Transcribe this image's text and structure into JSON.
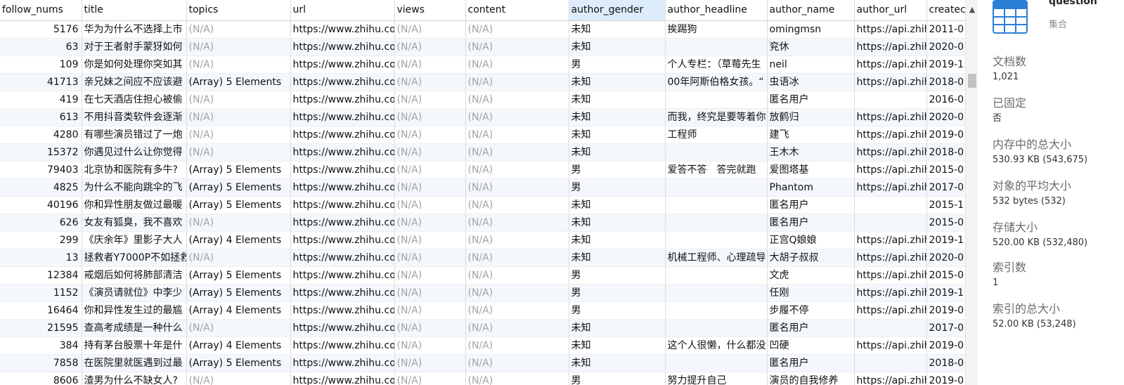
{
  "grid": {
    "columns": [
      {
        "key": "follow_nums",
        "label": "follow_nums",
        "width": 116
      },
      {
        "key": "title",
        "label": "title",
        "width": 149
      },
      {
        "key": "topics",
        "label": "topics",
        "width": 148
      },
      {
        "key": "url",
        "label": "url",
        "width": 148
      },
      {
        "key": "views",
        "label": "views",
        "width": 101
      },
      {
        "key": "content",
        "label": "content",
        "width": 147
      },
      {
        "key": "author_gender",
        "label": "author_gender",
        "width": 137,
        "selected": true
      },
      {
        "key": "author_headline",
        "label": "author_headline",
        "width": 145
      },
      {
        "key": "author_name",
        "label": "author_name",
        "width": 124
      },
      {
        "key": "author_url",
        "label": "author_url",
        "width": 103
      },
      {
        "key": "created",
        "label": "createc",
        "width": 55
      }
    ],
    "rows": [
      [
        "5176",
        "华为为什么不选择上市",
        "(N/A)",
        "https://www.zhihu.com",
        "(N/A)",
        "(N/A)",
        "未知",
        "挨踢狗",
        "omingmsn",
        "https://api.zhihu",
        "2011-0"
      ],
      [
        "63",
        "对于王者射手蒙犽如何",
        "(N/A)",
        "https://www.zhihu.com",
        "(N/A)",
        "(N/A)",
        "未知",
        "",
        "兖休",
        "https://api.zhihu",
        "2020-0"
      ],
      [
        "109",
        "你是如何处理你突如其",
        "(N/A)",
        "https://www.zhihu.com",
        "(N/A)",
        "(N/A)",
        "男",
        "个人专栏：（草莓先生",
        "neil",
        "https://api.zhihu",
        "2019-1"
      ],
      [
        "41713",
        "亲兄妹之间应不应该避",
        "(Array) 5 Elements",
        "https://www.zhihu.com",
        "(N/A)",
        "(N/A)",
        "未知",
        "00年阿斯伯格女孩。“",
        "虫语冰",
        "https://api.zhihu",
        "2018-0"
      ],
      [
        "419",
        "在七天酒店住担心被偷",
        "(N/A)",
        "https://www.zhihu.com",
        "(N/A)",
        "(N/A)",
        "未知",
        "",
        "匿名用户",
        "",
        "2016-0"
      ],
      [
        "613",
        "不用抖音类软件会逐渐",
        "(N/A)",
        "https://www.zhihu.com",
        "(N/A)",
        "(N/A)",
        "未知",
        "而我，终究是要等着你",
        "放鹤归",
        "https://api.zhihu",
        "2020-0"
      ],
      [
        "4280",
        "有哪些演员错过了一炮",
        "(N/A)",
        "https://www.zhihu.com",
        "(N/A)",
        "(N/A)",
        "未知",
        "工程师",
        "建飞",
        "https://api.zhihu",
        "2019-0"
      ],
      [
        "15372",
        "你遇见过什么让你觉得",
        "(N/A)",
        "https://www.zhihu.com",
        "(N/A)",
        "(N/A)",
        "未知",
        "",
        "王木木",
        "https://api.zhihu",
        "2018-0"
      ],
      [
        "79403",
        "北京协和医院有多牛?",
        "(Array) 5 Elements",
        "https://www.zhihu.com",
        "(N/A)",
        "(N/A)",
        "男",
        "爱答不答　答完就跑",
        "爱图塔基",
        "https://api.zhihu",
        "2015-0"
      ],
      [
        "4825",
        "为什么不能向跳伞的飞",
        "(Array) 5 Elements",
        "https://www.zhihu.com",
        "(N/A)",
        "(N/A)",
        "男",
        "",
        "Phantom",
        "https://api.zhihu",
        "2017-0"
      ],
      [
        "40196",
        "你和异性朋友做过最暖",
        "(Array) 5 Elements",
        "https://www.zhihu.com",
        "(N/A)",
        "(N/A)",
        "未知",
        "",
        "匿名用户",
        "",
        "2015-1"
      ],
      [
        "626",
        "女友有狐臭，我不喜欢",
        "(N/A)",
        "https://www.zhihu.com",
        "(N/A)",
        "(N/A)",
        "未知",
        "",
        "匿名用户",
        "",
        "2015-0"
      ],
      [
        "299",
        "《庆余年》里影子大人",
        "(Array) 4 Elements",
        "https://www.zhihu.com",
        "(N/A)",
        "(N/A)",
        "未知",
        "",
        "正宫Q娘娘",
        "https://api.zhihu",
        "2019-1"
      ],
      [
        "13",
        "拯救者Y7000P不如拯救",
        "(N/A)",
        "https://www.zhihu.com",
        "(N/A)",
        "(N/A)",
        "未知",
        "机械工程师、心理疏导",
        "大胡子叔叔",
        "https://api.zhihu",
        "2020-0"
      ],
      [
        "12384",
        "戒烟后如何将肺部清洁",
        "(Array) 5 Elements",
        "https://www.zhihu.com",
        "(N/A)",
        "(N/A)",
        "男",
        "",
        "文虎",
        "https://api.zhihu",
        "2015-0"
      ],
      [
        "1152",
        "《演员请就位》中李少",
        "(Array) 5 Elements",
        "https://www.zhihu.com",
        "(N/A)",
        "(N/A)",
        "男",
        "",
        "任刚",
        "https://api.zhihu",
        "2019-1"
      ],
      [
        "16464",
        "你和异性发生过的最尴",
        "(Array) 4 Elements",
        "https://www.zhihu.com",
        "(N/A)",
        "(N/A)",
        "男",
        "",
        "步履不停",
        "https://api.zhihu",
        "2019-0"
      ],
      [
        "21595",
        "查高考成绩是一种什么",
        "(N/A)",
        "https://www.zhihu.com",
        "(N/A)",
        "(N/A)",
        "未知",
        "",
        "匿名用户",
        "",
        "2017-0"
      ],
      [
        "384",
        "持有茅台股票十年是什",
        "(Array) 4 Elements",
        "https://www.zhihu.com",
        "(N/A)",
        "(N/A)",
        "未知",
        "这个人很懒，什么都没",
        "凹硬",
        "https://api.zhihu",
        "2019-0"
      ],
      [
        "7858",
        "在医院里就医遇到过最",
        "(Array) 5 Elements",
        "https://www.zhihu.com",
        "(N/A)",
        "(N/A)",
        "未知",
        "",
        "匿名用户",
        "",
        "2018-0"
      ],
      [
        "8606",
        "渣男为什么不缺女人?",
        "(N/A)",
        "https://www.zhihu.com",
        "(N/A)",
        "(N/A)",
        "男",
        "努力提升自己",
        "演员的自我修养",
        "https://api.zhihu",
        "2019-0"
      ]
    ]
  },
  "panel": {
    "collection_name": "question",
    "collection_type": "集合",
    "stats": [
      {
        "label": "文档数",
        "value": "1,021"
      },
      {
        "label": "已固定",
        "value": "否"
      },
      {
        "label": "内存中的总大小",
        "value": "530.93 KB (543,675)"
      },
      {
        "label": "对象的平均大小",
        "value": "532 bytes (532)"
      },
      {
        "label": "存储大小",
        "value": "520.00 KB (532,480)"
      },
      {
        "label": "索引数",
        "value": "1"
      },
      {
        "label": "索引的总大小",
        "value": "52.00 KB (53,248)"
      }
    ]
  },
  "colors": {
    "accent": "#2b7fd6",
    "selected_header": "#dcecfb",
    "alt_row": "#f4f8fd",
    "na_text": "#a3a3a3"
  },
  "icons": {
    "collection": "table-grid-icon",
    "scroll_up": "chevron-up-icon"
  }
}
